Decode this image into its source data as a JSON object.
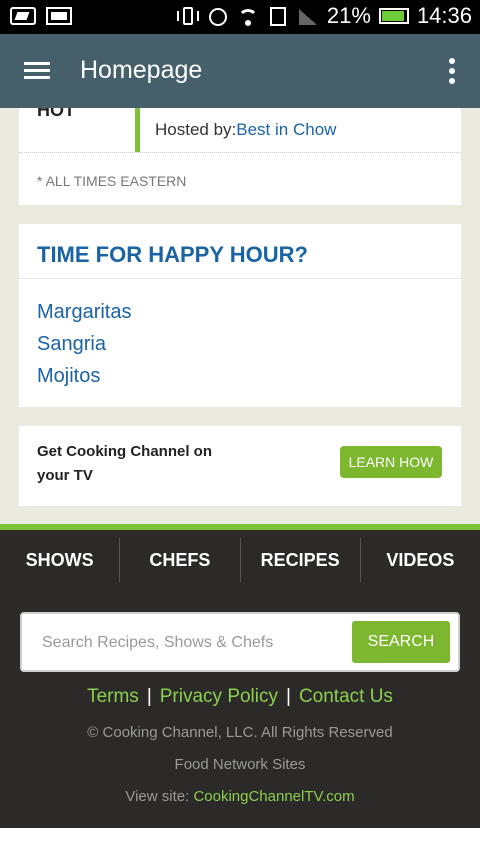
{
  "status_bar": {
    "battery": "21%",
    "time": "14:36",
    "icons": [
      "screenshot-icon",
      "image-icon",
      "vibrate-icon",
      "alarm-icon",
      "wifi-icon",
      "sd-card-icon",
      "signal-icon",
      "battery-icon"
    ]
  },
  "app_bar": {
    "title": "Homepage",
    "color": "#46606b"
  },
  "schedule": {
    "show_partial": "HOT",
    "host_label": "Hosted by:",
    "host_name": "Best in Chow",
    "note": "* ALL TIMES EASTERN"
  },
  "happy_hour": {
    "title": "TIME FOR HAPPY HOUR?",
    "items": [
      "Margaritas",
      "Sangria",
      "Mojitos"
    ]
  },
  "tv_promo": {
    "text": "Get Cooking Channel on your TV",
    "button": "LEARN HOW"
  },
  "footer": {
    "nav": [
      "SHOWS",
      "CHEFS",
      "RECIPES",
      "VIDEOS"
    ],
    "search_placeholder": "Search Recipes, Shows & Chefs",
    "search_button": "SEARCH",
    "links": [
      "Terms",
      "Privacy Policy",
      "Contact Us"
    ],
    "copyright": "© Cooking Channel, LLC. All Rights Reserved",
    "network": "Food Network Sites",
    "view_site_label": "View site:",
    "view_site_link": "CookingChannelTV.com",
    "accent": "#7dc13b"
  }
}
